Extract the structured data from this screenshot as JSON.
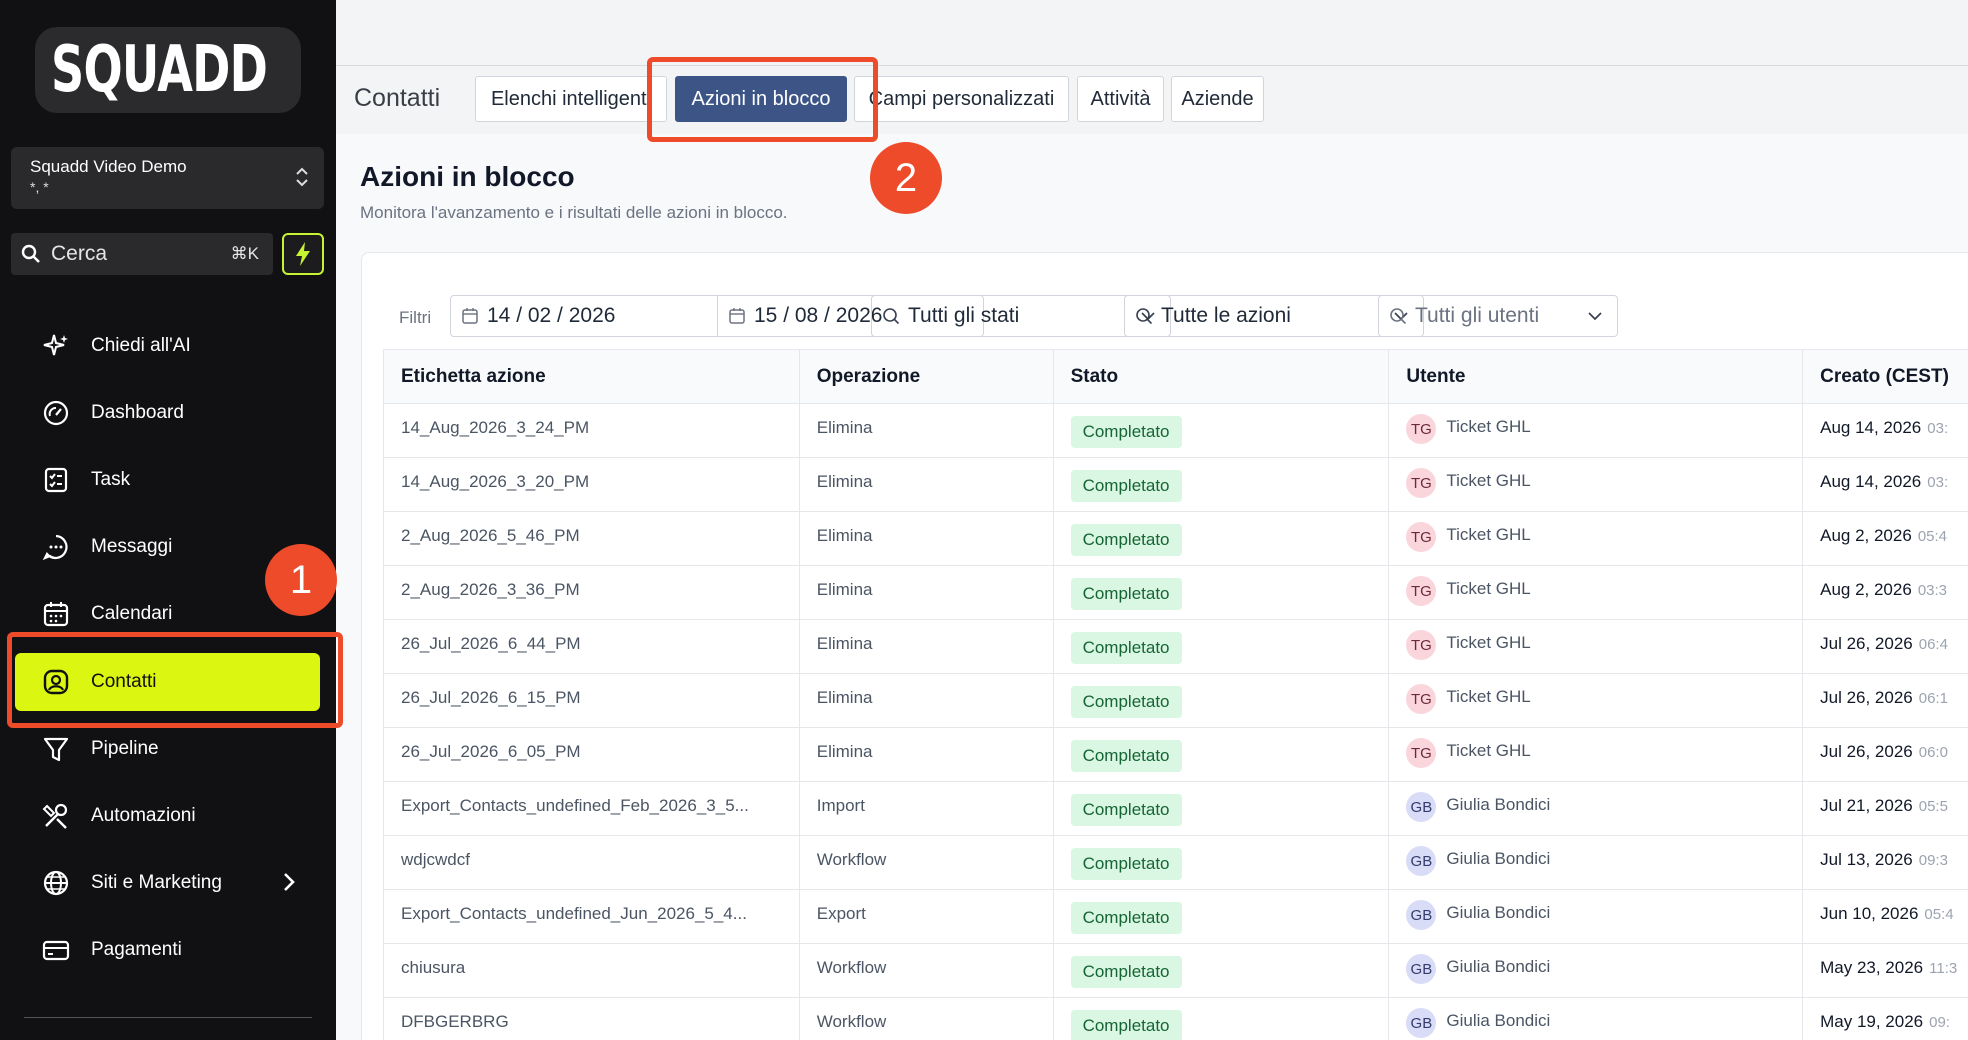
{
  "brand": {
    "name": "SQUADD"
  },
  "account": {
    "name": "Squadd Video Demo",
    "sub": "*, *"
  },
  "search": {
    "placeholder": "Cerca",
    "shortcut": "⌘K"
  },
  "nav": [
    {
      "label": "Chiedi all'AI",
      "icon": "sparkle-icon"
    },
    {
      "label": "Dashboard",
      "icon": "gauge-icon"
    },
    {
      "label": "Task",
      "icon": "checklist-icon"
    },
    {
      "label": "Messaggi",
      "icon": "chat-icon"
    },
    {
      "label": "Calendari",
      "icon": "calendar-icon"
    },
    {
      "label": "Contatti",
      "icon": "user-circle-icon",
      "active": true
    },
    {
      "label": "Pipeline",
      "icon": "funnel-icon"
    },
    {
      "label": "Automazioni",
      "icon": "tools-icon"
    },
    {
      "label": "Siti e Marketing",
      "icon": "globe-icon"
    },
    {
      "label": "Pagamenti",
      "icon": "card-icon"
    }
  ],
  "annotations": {
    "badge1": "1",
    "badge2": "2"
  },
  "header": {
    "section": "Contatti",
    "tabs": [
      "Elenchi intelligenti",
      "Azioni in blocco",
      "Campi personalizzati",
      "Attività",
      "Aziende"
    ],
    "active_tab": "Azioni in blocco"
  },
  "page": {
    "title": "Azioni in blocco",
    "subtitle": "Monitora l'avanzamento e i risultati delle azioni in blocco."
  },
  "filters": {
    "label": "Filtri",
    "date_from": "14 / 02 / 2026",
    "date_to": "15 / 08 / 2026",
    "status": "Tutti gli stati",
    "action": "Tutte le azioni",
    "user": "Tutti gli utenti"
  },
  "table": {
    "columns": [
      "Etichetta azione",
      "Operazione",
      "Stato",
      "Utente",
      "Creato (CEST)"
    ],
    "rows": [
      {
        "label": "14_Aug_2026_3_24_PM",
        "op": "Elimina",
        "status": "Completato",
        "initials": "TG",
        "user": "Ticket GHL",
        "date": "Aug 14, 2026",
        "time": "03:"
      },
      {
        "label": "14_Aug_2026_3_20_PM",
        "op": "Elimina",
        "status": "Completato",
        "initials": "TG",
        "user": "Ticket GHL",
        "date": "Aug 14, 2026",
        "time": "03:"
      },
      {
        "label": "2_Aug_2026_5_46_PM",
        "op": "Elimina",
        "status": "Completato",
        "initials": "TG",
        "user": "Ticket GHL",
        "date": "Aug 2, 2026",
        "time": "05:4"
      },
      {
        "label": "2_Aug_2026_3_36_PM",
        "op": "Elimina",
        "status": "Completato",
        "initials": "TG",
        "user": "Ticket GHL",
        "date": "Aug 2, 2026",
        "time": "03:3"
      },
      {
        "label": "26_Jul_2026_6_44_PM",
        "op": "Elimina",
        "status": "Completato",
        "initials": "TG",
        "user": "Ticket GHL",
        "date": "Jul 26, 2026",
        "time": "06:4"
      },
      {
        "label": "26_Jul_2026_6_15_PM",
        "op": "Elimina",
        "status": "Completato",
        "initials": "TG",
        "user": "Ticket GHL",
        "date": "Jul 26, 2026",
        "time": "06:1"
      },
      {
        "label": "26_Jul_2026_6_05_PM",
        "op": "Elimina",
        "status": "Completato",
        "initials": "TG",
        "user": "Ticket GHL",
        "date": "Jul 26, 2026",
        "time": "06:0"
      },
      {
        "label": "Export_Contacts_undefined_Feb_2026_3_5...",
        "op": "Import",
        "status": "Completato",
        "initials": "GB",
        "user": "Giulia Bondici",
        "date": "Jul 21, 2026",
        "time": "05:5"
      },
      {
        "label": "wdjcwdcf",
        "op": "Workflow",
        "status": "Completato",
        "initials": "GB",
        "user": "Giulia Bondici",
        "date": "Jul 13, 2026",
        "time": "09:3"
      },
      {
        "label": "Export_Contacts_undefined_Jun_2026_5_4...",
        "op": "Export",
        "status": "Completato",
        "initials": "GB",
        "user": "Giulia Bondici",
        "date": "Jun 10, 2026",
        "time": "05:4"
      },
      {
        "label": "chiusura",
        "op": "Workflow",
        "status": "Completato",
        "initials": "GB",
        "user": "Giulia Bondici",
        "date": "May 23, 2026",
        "time": "11:3"
      },
      {
        "label": "DFBGERBRG",
        "op": "Workflow",
        "status": "Completato",
        "initials": "GB",
        "user": "Giulia Bondici",
        "date": "May 19, 2026",
        "time": "09:"
      }
    ]
  },
  "colors": {
    "accent": "#dbf611",
    "active_tab": "#3d5487",
    "highlight": "#ee4b2b",
    "status_bg": "#d9f7e3"
  }
}
